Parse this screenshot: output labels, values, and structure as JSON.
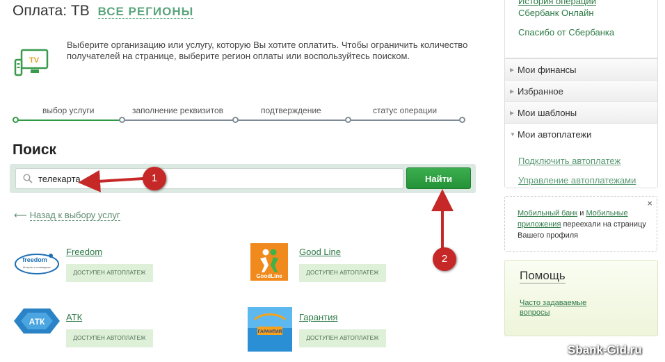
{
  "header": {
    "title": "Оплата: ТВ",
    "region": "ВСЕ РЕГИОНЫ",
    "icon": "tv-icon",
    "icon_label": "TV",
    "intro": "Выберите организацию или услугу, которую Вы хотите оплатить. Чтобы ограничить количество получателей на странице, выберите регион оплаты или воспользуйтесь поиском."
  },
  "steps": {
    "items": [
      {
        "label": "выбор услуги",
        "done": true
      },
      {
        "label": "заполнение реквизитов",
        "done": false
      },
      {
        "label": "подтверждение",
        "done": false
      },
      {
        "label": "статус операции",
        "done": false
      }
    ]
  },
  "search": {
    "title": "Поиск",
    "value": "телекарта",
    "button_label": "Найти",
    "back_label": "Назад к выбору услуг"
  },
  "providers": [
    {
      "name": "Freedom",
      "badge": "ДОСТУПЕН АВТОПЛАТЕЖ",
      "logo_text": "freedom",
      "logo_sub": "Интернет и телевидение"
    },
    {
      "name": "Good Line",
      "badge": "ДОСТУПЕН АВТОПЛАТЕЖ",
      "logo_text": "GoodLine"
    },
    {
      "name": "АТК",
      "badge": "ДОСТУПЕН АВТОПЛАТЕЖ",
      "logo_text": "АТК"
    },
    {
      "name": "Гарантия",
      "badge": "ДОСТУПЕН АВТОПЛАТЕЖ",
      "logo_text": "ГАРАНТИЯ"
    }
  ],
  "sidebar": {
    "top_links": [
      "История операций",
      "Сбербанк Онлайн",
      "Спасибо от Сбербанка"
    ],
    "menu": [
      "Мои финансы",
      "Избранное",
      "Мои шаблоны"
    ],
    "autopay": {
      "title": "Мои автоплатежи",
      "links": [
        "Подключить автоплатеж",
        "Управление автоплатежами"
      ]
    },
    "notice": {
      "link1": "Мобильный банк",
      "and": " и ",
      "link2": "Мобильные приложения",
      "rest": " переехали на страницу Вашего профиля",
      "close": "×"
    },
    "help": {
      "title": "Помощь",
      "link": "Часто задаваемые вопросы"
    }
  },
  "annotations": [
    "1",
    "2"
  ],
  "watermark": "Sbank-Gid.ru",
  "colors": {
    "accent_green": "#2f9a45",
    "link_green": "#2d7a46",
    "region_green": "#5aa57b",
    "badge_bg": "#dff0d8",
    "annotation_red": "#c62828"
  }
}
